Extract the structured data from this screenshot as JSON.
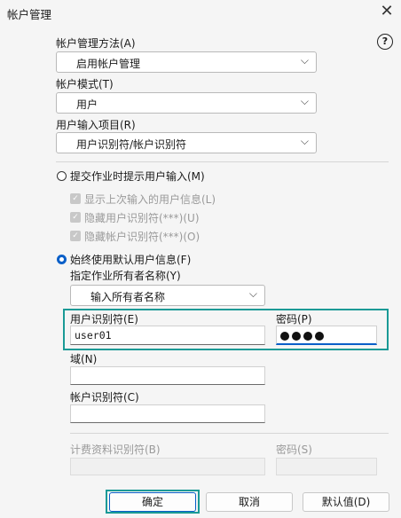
{
  "window": {
    "title": "帐户管理",
    "close_glyph": "✕",
    "help_glyph": "?"
  },
  "method": {
    "label": "帐户管理方法(A)",
    "value": "启用帐户管理"
  },
  "mode": {
    "label": "帐户模式(T)",
    "value": "用户"
  },
  "input_item": {
    "label": "用户输入项目(R)",
    "value": "用户识别符/帐户识别符"
  },
  "prompt_option": {
    "label": "提交作业时提示用户输入(M)",
    "sub": [
      "显示上次输入的用户信息(L)",
      "隐藏用户识别符(***)(U)",
      "隐藏帐户识别符(***)(O)"
    ]
  },
  "default_option": {
    "label": "始终使用默认用户信息(F)"
  },
  "owner": {
    "label": "指定作业所有者名称(Y)",
    "value": "输入所有者名称"
  },
  "user_id": {
    "label": "用户识别符(E)",
    "value": "user01"
  },
  "password": {
    "label": "密码(P)",
    "dots": 4
  },
  "domain": {
    "label": "域(N)",
    "value": ""
  },
  "account_id": {
    "label": "帐户识别符(C)",
    "value": ""
  },
  "billing_id": {
    "label": "计费资料识别符(B)",
    "value": ""
  },
  "billing_password": {
    "label": "密码(S)",
    "value": ""
  },
  "buttons": {
    "ok": "确定",
    "cancel": "取消",
    "default": "默认值(D)"
  },
  "icons": {
    "close": "close-icon",
    "help": "help-icon",
    "chevron": "chevron-down-icon",
    "check": "checkmark-icon"
  },
  "colors": {
    "accent": "#0a5fc8",
    "highlight": "#1a9a96"
  }
}
